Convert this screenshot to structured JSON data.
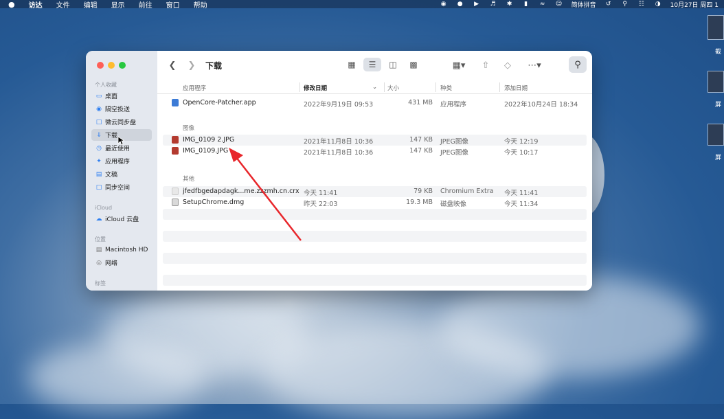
{
  "menubar": {
    "apple": "",
    "menus": [
      "访达",
      "文件",
      "编辑",
      "显示",
      "前往",
      "窗口",
      "帮助"
    ],
    "input_method": "简体拼音",
    "clock": "10月27日 周四 1"
  },
  "desktop": {
    "icon_labels": [
      "截",
      "屏",
      "屏"
    ]
  },
  "window": {
    "title": "下载",
    "sidebar": {
      "favorites_header": "个人收藏",
      "favorites": [
        "桌面",
        "隔空投送",
        "微云同步盘",
        "下载",
        "最近使用",
        "应用程序",
        "文稿",
        "同步空间"
      ],
      "active_index": 3,
      "icloud_header": "iCloud",
      "icloud": [
        "iCloud 云盘"
      ],
      "locations_header": "位置",
      "locations": [
        "Macintosh HD",
        "网络"
      ],
      "tags_header": "标签"
    },
    "columns": {
      "name": "应用程序",
      "modified": "修改日期",
      "size": "大小",
      "kind": "种类",
      "added": "添加日期"
    },
    "groups": [
      {
        "label": "",
        "rows": [
          {
            "name": "OpenCore-Patcher.app",
            "modified": "2022年9月19日 09:53",
            "size": "431 MB",
            "kind": "应用程序",
            "added": "2022年10月24日 18:34",
            "icon": "app-icon"
          }
        ]
      },
      {
        "label": "图像",
        "rows": [
          {
            "name": "IMG_0109 2.JPG",
            "modified": "2021年11月8日 10:36",
            "size": "147 KB",
            "kind": "JPEG图像",
            "added": "今天 12:19",
            "icon": "image-icon"
          },
          {
            "name": "IMG_0109.JPG",
            "modified": "2021年11月8日 10:36",
            "size": "147 KB",
            "kind": "JPEG图像",
            "added": "今天 10:17",
            "icon": "image-icon"
          }
        ]
      },
      {
        "label": "其他",
        "rows": [
          {
            "name": "jfedfbgedapdagk...me.zzzmh.cn.crx",
            "modified": "今天 11:41",
            "size": "79 KB",
            "kind": "Chromium Extra",
            "added": "今天 11:41",
            "icon": "extension-icon"
          },
          {
            "name": "SetupChrome.dmg",
            "modified": "昨天 22:03",
            "size": "19.3 MB",
            "kind": "磁盘映像",
            "added": "今天 11:34",
            "icon": "disk-image-icon"
          }
        ]
      }
    ]
  },
  "colors": {
    "accent": "#2d7ef0",
    "annotation_arrow": "#e8262b",
    "close": "#fe5f57",
    "minimize": "#febc2e",
    "zoom": "#28c840"
  }
}
